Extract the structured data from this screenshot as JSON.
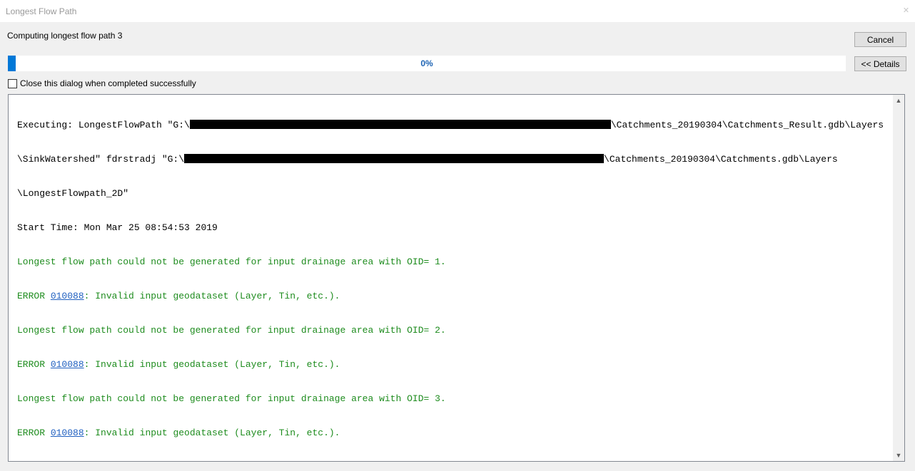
{
  "window": {
    "title": "Longest Flow Path",
    "close_glyph": "✕"
  },
  "status_text": "Computing longest flow path 3",
  "buttons": {
    "cancel": "Cancel",
    "details": "<< Details"
  },
  "progress": {
    "percent": 0,
    "label": "0%"
  },
  "close_on_complete": {
    "label": "Close this dialog when completed successfully",
    "checked": false
  },
  "log": {
    "line1_prefix": "Executing: LongestFlowPath \"G:\\",
    "line1_suffix": "\\Catchments_20190304\\Catchments_Result.gdb\\Layers",
    "line2_prefix": "\\SinkWatershed\" fdrstradj \"G:\\",
    "line2_suffix": "\\Catchments_20190304\\Catchments.gdb\\Layers",
    "line3": "\\LongestFlowpath_2D\"",
    "line4": "Start Time: Mon Mar 25 08:54:53 2019",
    "warn1": "Longest flow path could not be generated for input drainage area with OID= 1.",
    "err_prefix": "ERROR ",
    "err_code": "010088",
    "err_suffix": ": Invalid input geodataset (Layer, Tin, etc.).",
    "warn2": "Longest flow path could not be generated for input drainage area with OID= 2.",
    "warn3": "Longest flow path could not be generated for input drainage area with OID= 3."
  },
  "colors": {
    "progress_fill": "#0078d7",
    "message_green": "#1e8c1e",
    "link_blue": "#2060c0"
  }
}
